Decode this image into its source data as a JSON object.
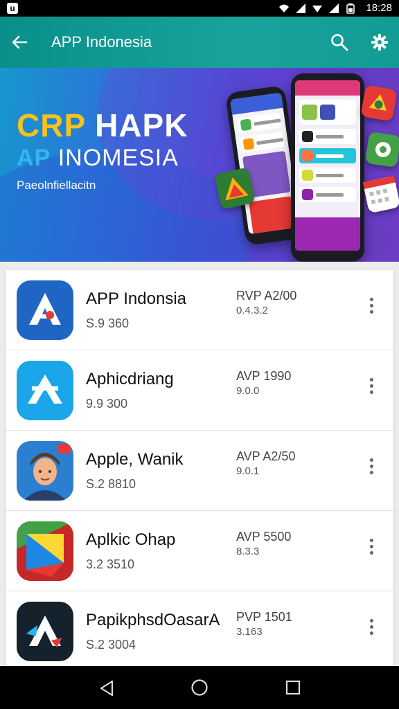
{
  "status_bar": {
    "time": "18:28",
    "left_icon_letter": "u"
  },
  "app_bar": {
    "title": "APP Indonesia"
  },
  "banner": {
    "headline_accent": "CRP",
    "headline_rest": " HAPK",
    "sub_accent": "AP",
    "sub_rest": "INOMESIA",
    "tagline": "Paeolnfiellacitn"
  },
  "apps": [
    {
      "name": "APP Indonsia",
      "size": "S.9 360",
      "price": "RVP A2/00",
      "version": "0.4.3.2",
      "icon": "a-logo-blue-icon"
    },
    {
      "name": "Aphicdriang",
      "size": "9.9 300",
      "price": "AVP 1990",
      "version": "9.0.0",
      "icon": "a-logo-lightblue-icon"
    },
    {
      "name": "Apple, Wanik",
      "size": "S.2 8810",
      "price": "AVP A2/50",
      "version": "9.0.1",
      "icon": "avatar-man-icon"
    },
    {
      "name": "Aplkic Ohap",
      "size": "3.2 3510",
      "price": "AVP 5500",
      "version": "8.3.3",
      "icon": "play-logo-icon"
    },
    {
      "name": "PapikphsdOasarA",
      "size": "S.2 3004",
      "price": "PVP 1501",
      "version": "3.163",
      "icon": "a-logo-dark-icon"
    }
  ],
  "colors": {
    "app_bar": "#0a8f8b",
    "accent": "#f6c21c",
    "status_bar": "#000000"
  }
}
